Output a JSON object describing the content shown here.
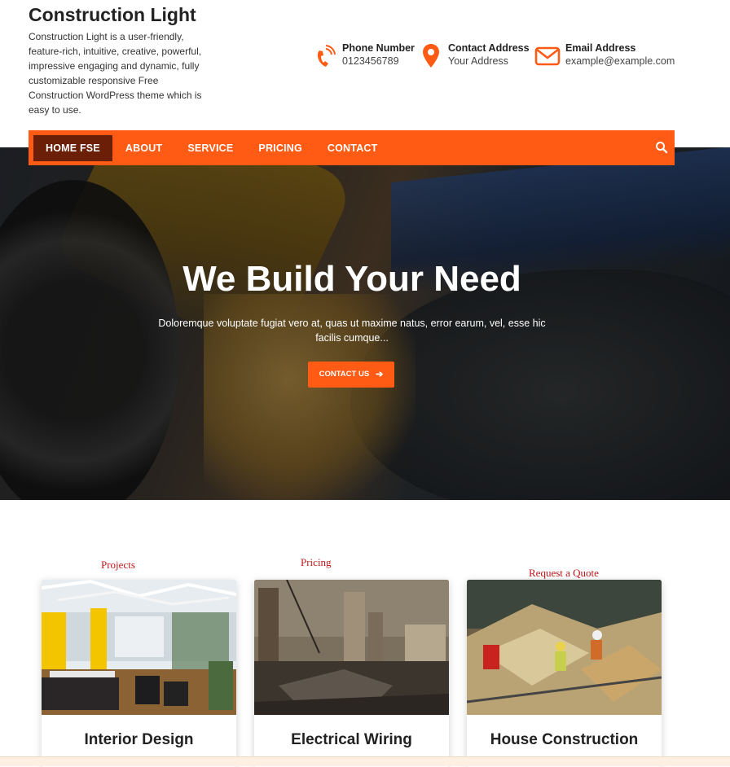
{
  "site": {
    "title": "Construction Light",
    "description": "Construction Light is a user-friendly, feature-rich, intuitive, creative, powerful, impressive engaging and dynamic, fully customizable responsive Free Construction WordPress theme which is easy to use."
  },
  "contacts": [
    {
      "icon": "phone-icon",
      "title": "Phone Number",
      "value": "0123456789"
    },
    {
      "icon": "map-pin-icon",
      "title": "Contact Address",
      "value": "Your Address"
    },
    {
      "icon": "envelope-icon",
      "title": "Email Address",
      "value": "example@example.com"
    }
  ],
  "nav": {
    "items": [
      {
        "label": "HOME FSE",
        "active": true
      },
      {
        "label": "ABOUT"
      },
      {
        "label": "SERVICE"
      },
      {
        "label": "PRICING"
      },
      {
        "label": "CONTACT"
      }
    ],
    "search_icon": "search-icon"
  },
  "hero": {
    "title": "We Build Your Need",
    "text": "Doloremque voluptate fugiat vero at, quas ut maxime natus, error earum, vel, esse hic facilis cumque...",
    "button_label": "CONTACT US",
    "button_icon": "arrow-right-icon"
  },
  "section_labels": {
    "projects": "Projects",
    "pricing": "Pricing",
    "quote": "Request a Quote"
  },
  "services": [
    {
      "title": "Interior Design"
    },
    {
      "title": "Electrical Wiring"
    },
    {
      "title": "House Construction"
    }
  ],
  "colors": {
    "accent": "#ff5b14",
    "active_nav": "#6a1f06",
    "label_red": "#c0181c"
  }
}
